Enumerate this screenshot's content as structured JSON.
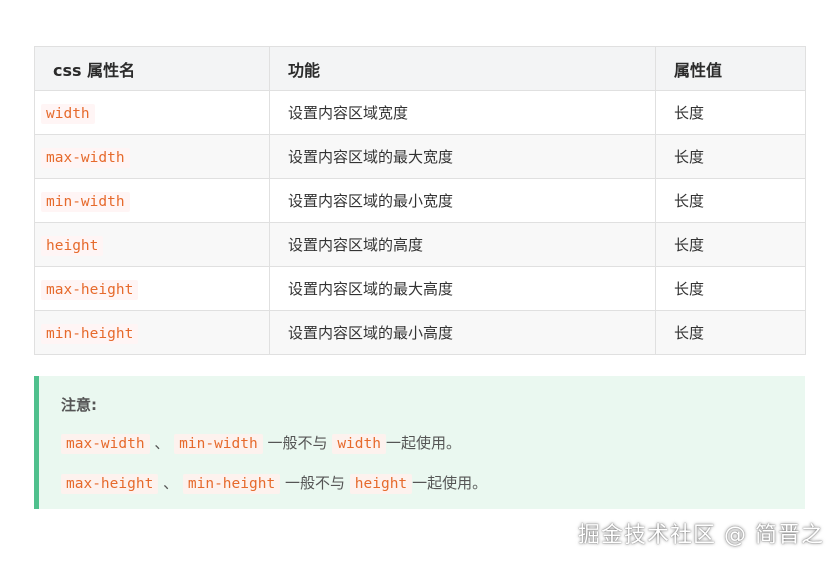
{
  "table": {
    "headers": [
      "css 属性名",
      "功能",
      "属性值"
    ],
    "rows": [
      {
        "property": "width",
        "function": "设置内容区域宽度",
        "value": "长度"
      },
      {
        "property": "max-width",
        "function": "设置内容区域的最大宽度",
        "value": "长度"
      },
      {
        "property": "min-width",
        "function": "设置内容区域的最小宽度",
        "value": "长度"
      },
      {
        "property": "height",
        "function": "设置内容区域的高度",
        "value": "长度"
      },
      {
        "property": "max-height",
        "function": "设置内容区域的最大高度",
        "value": "长度"
      },
      {
        "property": "min-height",
        "function": "设置内容区域的最小高度",
        "value": "长度"
      }
    ]
  },
  "note": {
    "title": "注意:",
    "line1": {
      "code1": "max-width",
      "sep": "、",
      "code2": "min-width",
      "mid": "一般不与",
      "code3": "width",
      "end": "一起使用。"
    },
    "line2": {
      "code1": "max-height",
      "sep": "、",
      "code2": "min-height",
      "mid": "一般不与",
      "code3": "height",
      "end": "一起使用。"
    }
  },
  "watermark": "掘金技术社区 @ 简晋之"
}
